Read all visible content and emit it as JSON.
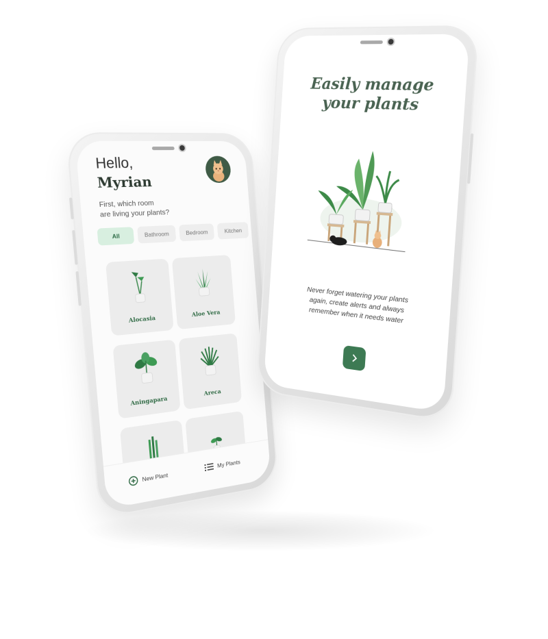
{
  "left_screen": {
    "greeting": "Hello,",
    "username": "Myrian",
    "subtitle_line1": "First, which room",
    "subtitle_line2": "are living your plants?",
    "categories": [
      "All",
      "Bathroom",
      "Bedroom",
      "Kitchen"
    ],
    "selected_category": "All",
    "plants": [
      {
        "name": "Alocasia",
        "icon": "alocasia-plant-icon"
      },
      {
        "name": "Aloe Vera",
        "icon": "aloe-vera-plant-icon"
      },
      {
        "name": "Aningapara",
        "icon": "aningapara-plant-icon"
      },
      {
        "name": "Areca",
        "icon": "areca-plant-icon"
      },
      {
        "name": "",
        "icon": "bamboo-plant-icon"
      },
      {
        "name": "",
        "icon": "sprout-plant-icon"
      }
    ],
    "bottom_nav": {
      "new_plant": "New Plant",
      "my_plants": "My Plants"
    },
    "colors": {
      "accent": "#2f6a44",
      "chip_active_bg": "#d8efe0"
    }
  },
  "right_screen": {
    "headline_line1": "Easily manage",
    "headline_line2": "your plants",
    "description_line1": "Never forget watering your plants",
    "description_line2": "again, create alerts and always",
    "description_line3": "remember when it needs water",
    "next_icon": "chevron-right-icon",
    "colors": {
      "button": "#3d7a53",
      "headline": "#4a6352"
    }
  }
}
